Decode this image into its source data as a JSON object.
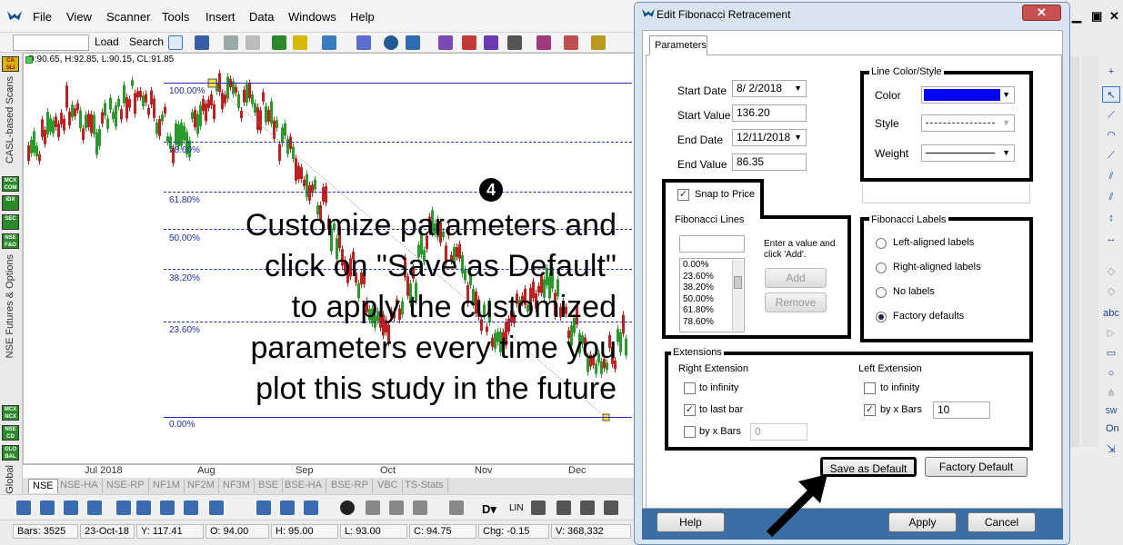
{
  "menubar": {
    "items": [
      "File",
      "View",
      "Scanner",
      "Tools",
      "Insert",
      "Data",
      "Windows",
      "Help"
    ]
  },
  "toolbar": {
    "load_label": "Load",
    "search_label": "Search"
  },
  "left_rail": {
    "badges": [
      "CA SLI",
      "MCX COM",
      "IDX",
      "SEC",
      "NSE F&O",
      "MCX NCX",
      "NSE CD",
      "GLO BAL"
    ],
    "section_scans": "CASL-based Scans",
    "section_futures": "NSE Futures & Options",
    "section_global": "Global"
  },
  "chart": {
    "quote": "O:90.65, H:92.85, L:90.15, CL:91.85",
    "fib_levels": [
      "100.00%",
      "78.60%",
      "61.80%",
      "50.00%",
      "38.20%",
      "23.60%",
      "0.00%"
    ],
    "x_labels": [
      "Jul 2018",
      "Aug",
      "Sep",
      "Oct",
      "Nov",
      "Dec"
    ],
    "overlay_lines": [
      "Customize parameters and",
      "click on \"Save as Default\"",
      "to apply the customized",
      "parameters every time you",
      "plot this study in the future"
    ],
    "step": "4"
  },
  "tabs": [
    "NSE",
    "NSE-HA",
    "NSE-RP",
    "NF1M",
    "NF2M",
    "NF3M",
    "BSE",
    "BSE-HA",
    "BSE-RP",
    "VBC",
    "TS-Stats"
  ],
  "status": {
    "bars": "Bars: 3525",
    "date": "23-Oct-18",
    "y": "Y: 117.41",
    "o": "O: 94.00",
    "h": "H: 95.00",
    "l": "L: 93.00",
    "c": "C: 94.75",
    "chg": "Chg: -0.15",
    "v": "V: 368,332"
  },
  "bottom_tools": {
    "lin_label": "LIN"
  },
  "right_panel": {
    "on_label": "On"
  },
  "dialog": {
    "title": "Edit Fibonacci Retracement",
    "close": "✕",
    "tab": "Parameters",
    "start_date_label": "Start Date",
    "start_date": "8/ 2/2018",
    "start_value_label": "Start Value",
    "start_value": "136.20",
    "end_date_label": "End Date",
    "end_date": "12/11/2018",
    "end_value_label": "End Value",
    "end_value": "86.35",
    "line_group": "Line Color/Style",
    "color_label": "Color",
    "style_label": "Style",
    "weight_label": "Weight",
    "line_color": "#0000ff",
    "snap_label": "Snap to Price",
    "fib_lines_title": "Fibonacci Lines",
    "fib_list": [
      "0.00%",
      "23.60%",
      "38.20%",
      "50.00%",
      "61.80%",
      "78.60%"
    ],
    "hint": "Enter a value and click 'Add'.",
    "add": "Add",
    "remove": "Remove",
    "fib_labels_title": "Fibonacci Labels",
    "label_options": [
      "Left-aligned labels",
      "Right-aligned labels",
      "No labels",
      "Factory defaults"
    ],
    "extensions_title": "Extensions",
    "right_ext_title": "Right Extension",
    "left_ext_title": "Left Extension",
    "to_infinity": "to infinity",
    "to_last_bar": "to last bar",
    "by_x_bars": "by x Bars",
    "right_x_value": "0",
    "left_x_value": "10",
    "save_default": "Save as Default",
    "factory_default": "Factory Default",
    "help": "Help",
    "apply": "Apply",
    "cancel": "Cancel"
  }
}
